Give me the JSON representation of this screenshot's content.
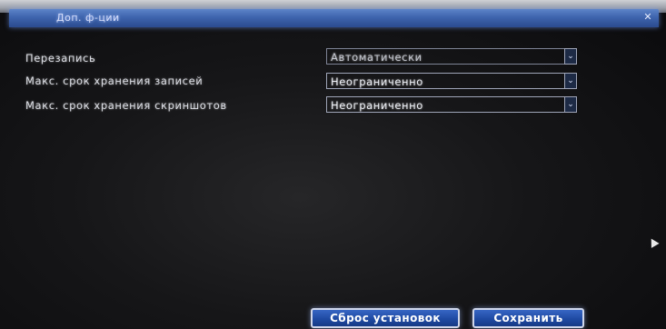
{
  "window": {
    "title": "Доп. ф-ции",
    "close_glyph": "✕"
  },
  "settings": [
    {
      "label": "Перезапись",
      "value": "Автоматически"
    },
    {
      "label": "Макс. срок хранения записей",
      "value": "Неограниченно"
    },
    {
      "label": "Макс. срок хранения скриншотов",
      "value": "Неограниченно"
    }
  ],
  "dropdown_glyph": "⌄",
  "buttons": {
    "reset": "Сброс установок",
    "save": "Сохранить"
  }
}
